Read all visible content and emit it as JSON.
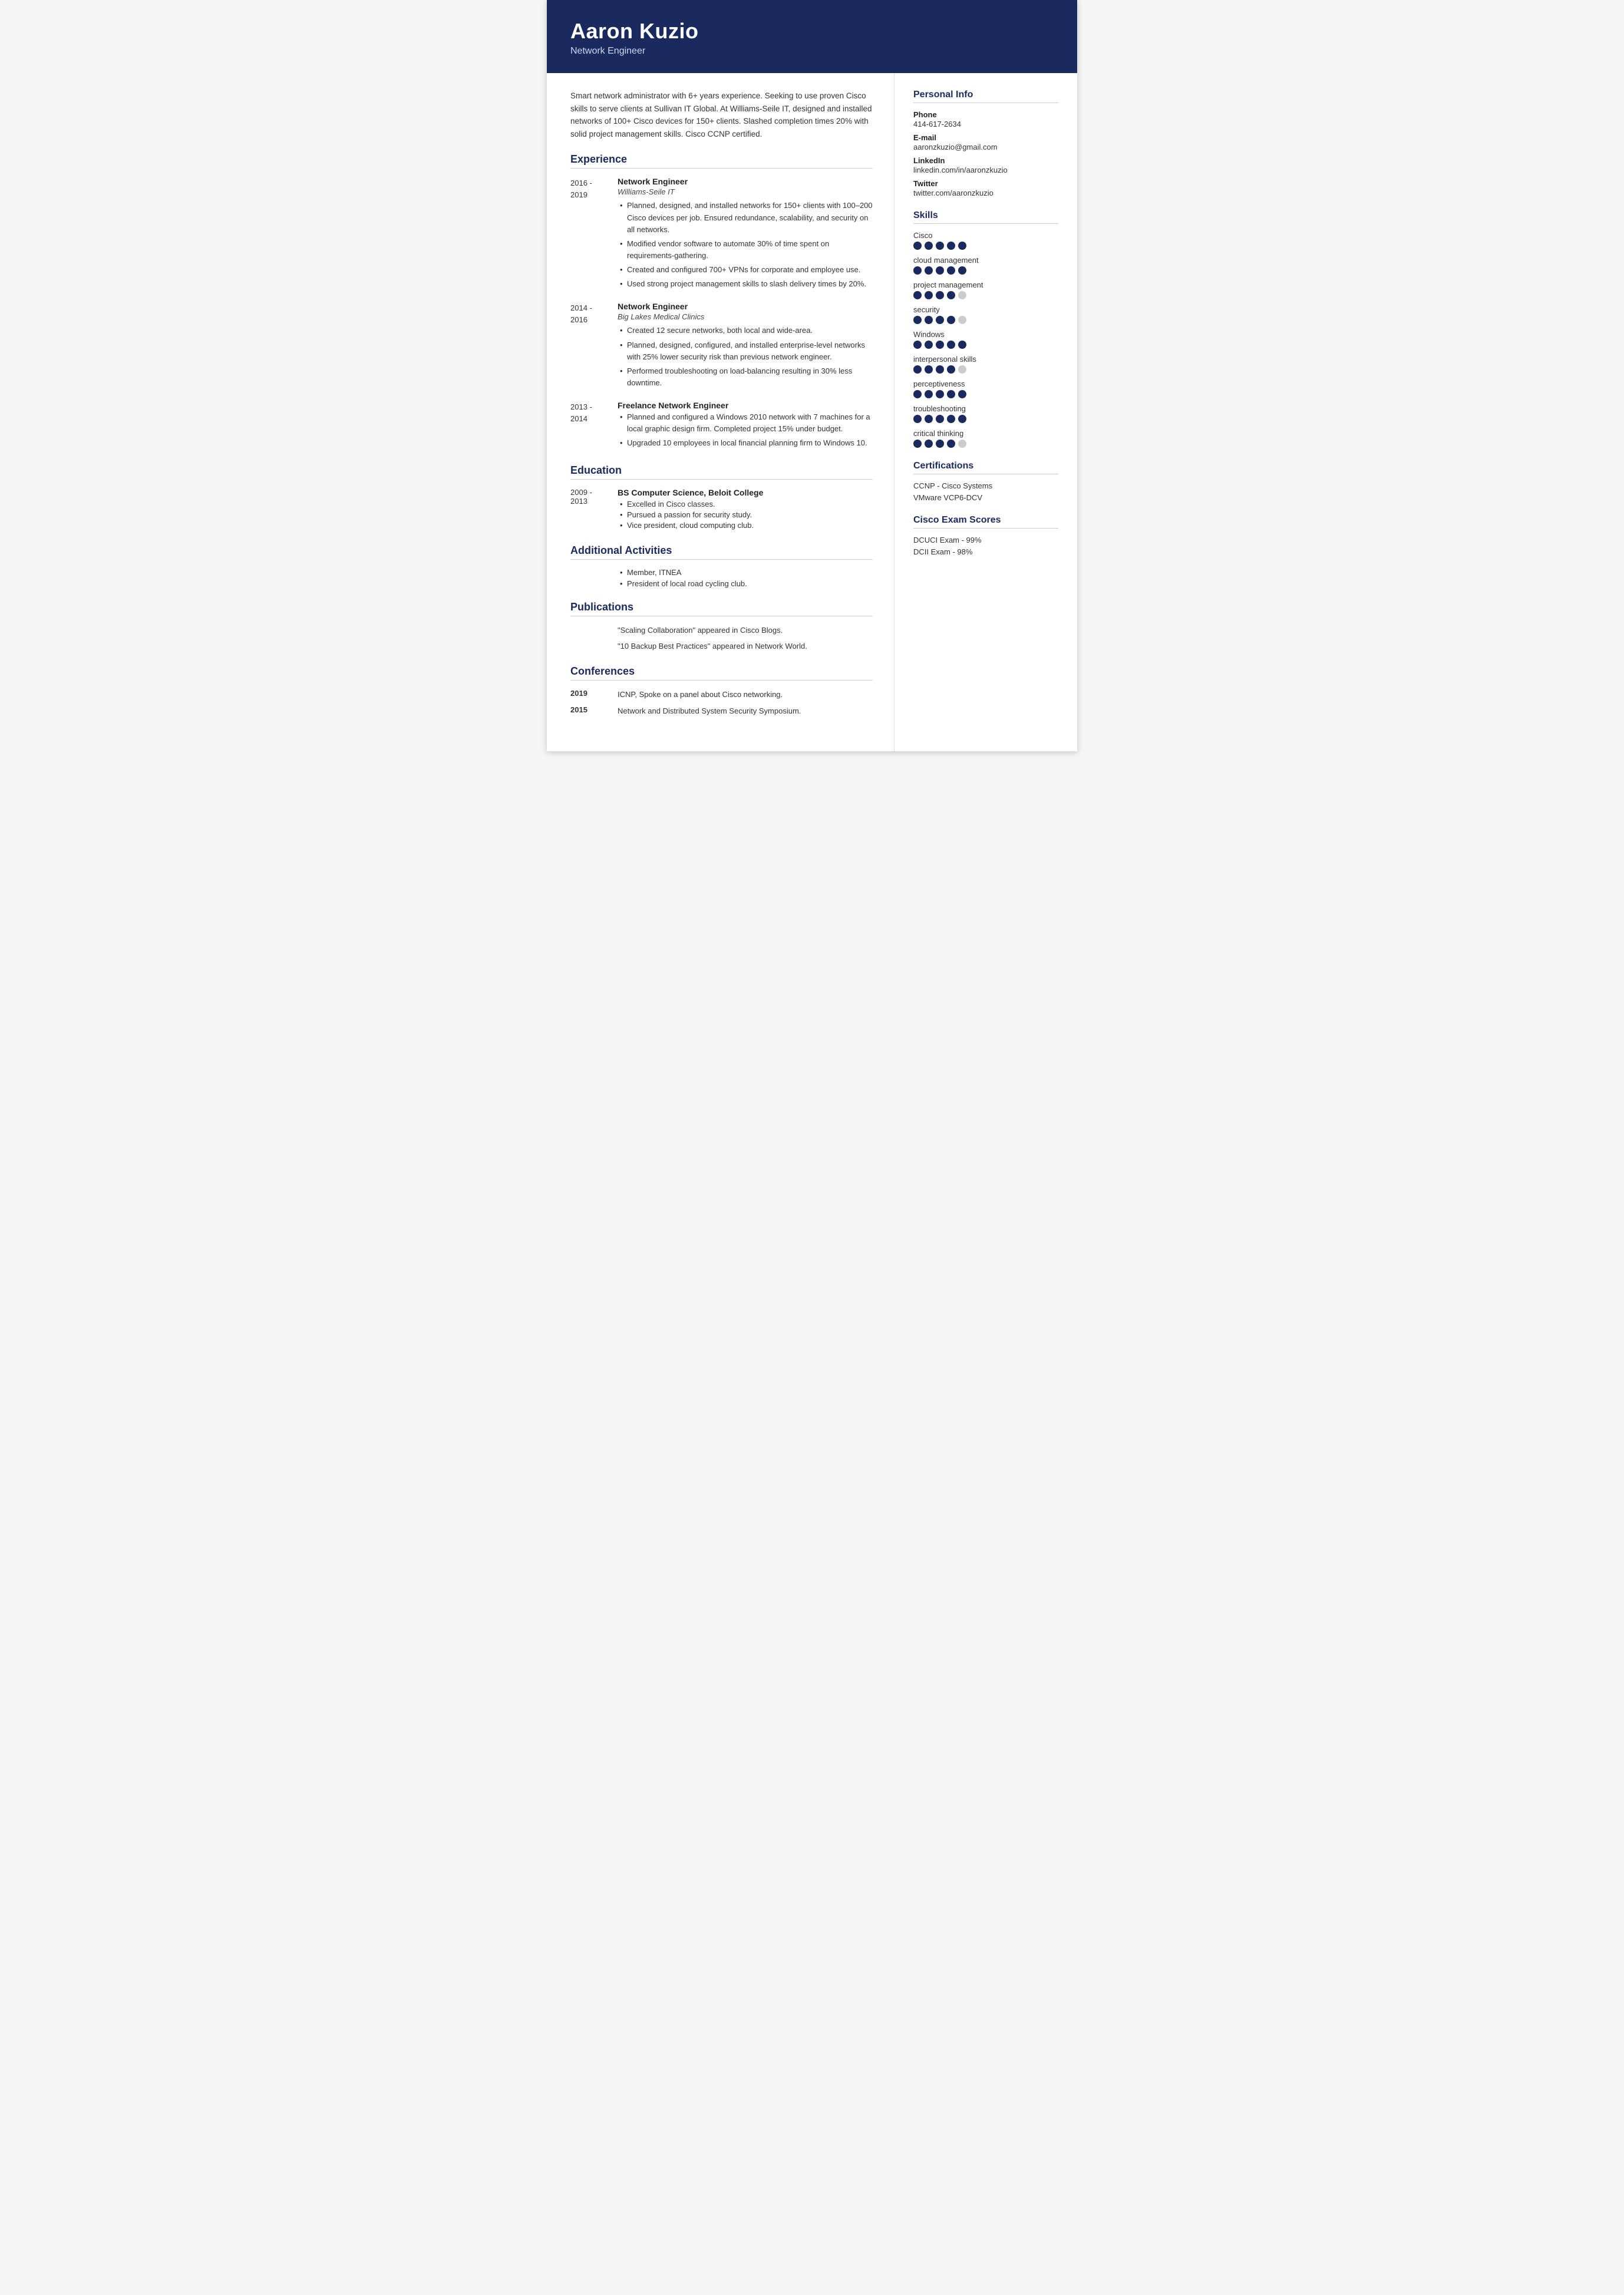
{
  "header": {
    "name": "Aaron Kuzio",
    "title": "Network Engineer"
  },
  "summary": "Smart network administrator with 6+ years experience. Seeking to use proven Cisco skills to serve clients at Sullivan IT Global. At Williams-Seile IT, designed and installed networks of 100+ Cisco devices for 150+ clients. Slashed completion times 20% with solid project management skills. Cisco CCNP certified.",
  "sections": {
    "experience": {
      "title": "Experience",
      "items": [
        {
          "date_start": "2016 -",
          "date_end": "2019",
          "job_title": "Network Engineer",
          "company": "Williams-Seile IT",
          "bullets": [
            "Planned, designed, and installed networks for 150+ clients with 100–200 Cisco devices per job. Ensured redundance, scalability, and security on all networks.",
            "Modified vendor software to automate 30% of time spent on requirements-gathering.",
            "Created and configured 700+ VPNs for corporate and employee use.",
            "Used strong project management skills to slash delivery times by 20%."
          ]
        },
        {
          "date_start": "2014 -",
          "date_end": "2016",
          "job_title": "Network Engineer",
          "company": "Big Lakes Medical Clinics",
          "bullets": [
            "Created 12 secure networks, both local and wide-area.",
            "Planned, designed, configured, and installed enterprise-level networks with 25% lower security risk than previous network engineer.",
            "Performed troubleshooting on load-balancing resulting in 30% less downtime."
          ]
        },
        {
          "date_start": "2013 -",
          "date_end": "2014",
          "job_title": "Freelance Network Engineer",
          "company": "",
          "bullets": [
            "Planned and configured a Windows 2010 network with 7 machines for a local graphic design firm. Completed project 15% under budget.",
            "Upgraded 10 employees in local financial planning firm to Windows 10."
          ]
        }
      ]
    },
    "education": {
      "title": "Education",
      "items": [
        {
          "date_start": "2009 -",
          "date_end": "2013",
          "degree": "BS Computer Science, Beloit College",
          "bullets": [
            "Excelled in Cisco classes.",
            "Pursued a passion for security study.",
            "Vice president, cloud computing club."
          ]
        }
      ]
    },
    "additional_activities": {
      "title": "Additional Activities",
      "bullets": [
        "Member, ITNEA",
        "President of local road cycling club."
      ]
    },
    "publications": {
      "title": "Publications",
      "items": [
        "\"Scaling Collaboration\" appeared in Cisco Blogs.",
        "\"10 Backup Best Practices\" appeared in Network World."
      ]
    },
    "conferences": {
      "title": "Conferences",
      "items": [
        {
          "year": "2019",
          "desc": "ICNP, Spoke on a panel about Cisco networking."
        },
        {
          "year": "2015",
          "desc": "Network and Distributed System Security Symposium."
        }
      ]
    }
  },
  "right": {
    "personal_info": {
      "title": "Personal Info",
      "items": [
        {
          "label": "Phone",
          "value": "414-617-2634"
        },
        {
          "label": "E-mail",
          "value": "aaronzkuzio@gmail.com"
        },
        {
          "label": "LinkedIn",
          "value": "linkedin.com/in/aaronzkuzio"
        },
        {
          "label": "Twitter",
          "value": "twitter.com/aaronzkuzio"
        }
      ]
    },
    "skills": {
      "title": "Skills",
      "items": [
        {
          "name": "Cisco",
          "filled": 5,
          "total": 5
        },
        {
          "name": "cloud management",
          "filled": 5,
          "total": 5
        },
        {
          "name": "project management",
          "filled": 4,
          "total": 5
        },
        {
          "name": "security",
          "filled": 4,
          "total": 5
        },
        {
          "name": "Windows",
          "filled": 5,
          "total": 5
        },
        {
          "name": "interpersonal skills",
          "filled": 4,
          "total": 5
        },
        {
          "name": "perceptiveness",
          "filled": 5,
          "total": 5
        },
        {
          "name": "troubleshooting",
          "filled": 5,
          "total": 5
        },
        {
          "name": "critical thinking",
          "filled": 4,
          "total": 5
        }
      ]
    },
    "certifications": {
      "title": "Certifications",
      "items": [
        "CCNP - Cisco Systems",
        "VMware VCP6-DCV"
      ]
    },
    "cisco_exam_scores": {
      "title": "Cisco Exam Scores",
      "items": [
        "DCUCI Exam - 99%",
        "DCII Exam - 98%"
      ]
    }
  }
}
